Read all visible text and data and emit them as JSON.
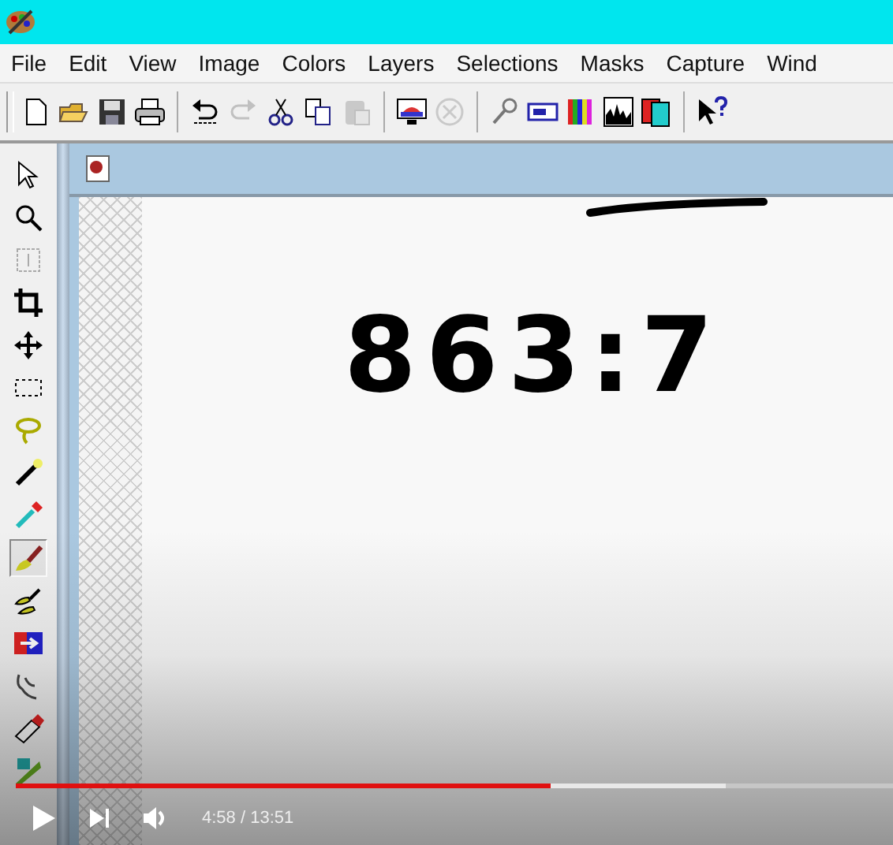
{
  "menu": [
    "File",
    "Edit",
    "View",
    "Image",
    "Colors",
    "Layers",
    "Selections",
    "Masks",
    "Capture",
    "Wind"
  ],
  "toolbar": [
    [
      {
        "kind": "new",
        "disabled": false
      },
      {
        "kind": "open",
        "disabled": false
      },
      {
        "kind": "save",
        "disabled": false
      },
      {
        "kind": "print",
        "disabled": false
      }
    ],
    [
      {
        "kind": "undo",
        "disabled": false
      },
      {
        "kind": "redo",
        "disabled": true
      },
      {
        "kind": "cut",
        "disabled": false
      },
      {
        "kind": "copy",
        "disabled": false
      },
      {
        "kind": "paste",
        "disabled": true
      }
    ],
    [
      {
        "kind": "monitor",
        "disabled": false
      },
      {
        "kind": "cancel",
        "disabled": true
      }
    ],
    [
      {
        "kind": "pick",
        "disabled": false
      },
      {
        "kind": "panel",
        "disabled": false
      },
      {
        "kind": "colors",
        "disabled": false
      },
      {
        "kind": "histogram",
        "disabled": false
      },
      {
        "kind": "layers",
        "disabled": false
      }
    ],
    [
      {
        "kind": "help",
        "disabled": false
      }
    ]
  ],
  "tools": [
    {
      "kind": "arrow",
      "selected": false
    },
    {
      "kind": "zoom",
      "selected": false
    },
    {
      "kind": "deform",
      "selected": false
    },
    {
      "kind": "crop",
      "selected": false
    },
    {
      "kind": "move",
      "selected": false
    },
    {
      "kind": "selection",
      "selected": false
    },
    {
      "kind": "lasso",
      "selected": false
    },
    {
      "kind": "wand",
      "selected": false
    },
    {
      "kind": "dropper",
      "selected": false
    },
    {
      "kind": "brush",
      "selected": true
    },
    {
      "kind": "clone",
      "selected": false
    },
    {
      "kind": "replace",
      "selected": false
    },
    {
      "kind": "retouch",
      "selected": false
    },
    {
      "kind": "eraser",
      "selected": false
    },
    {
      "kind": "tube",
      "selected": false
    }
  ],
  "canvas": {
    "text": "863:7"
  },
  "player": {
    "progress": {
      "level": 0.61
    },
    "buffer": {
      "level": 0.81
    },
    "time": "4:58 / 13:51"
  }
}
